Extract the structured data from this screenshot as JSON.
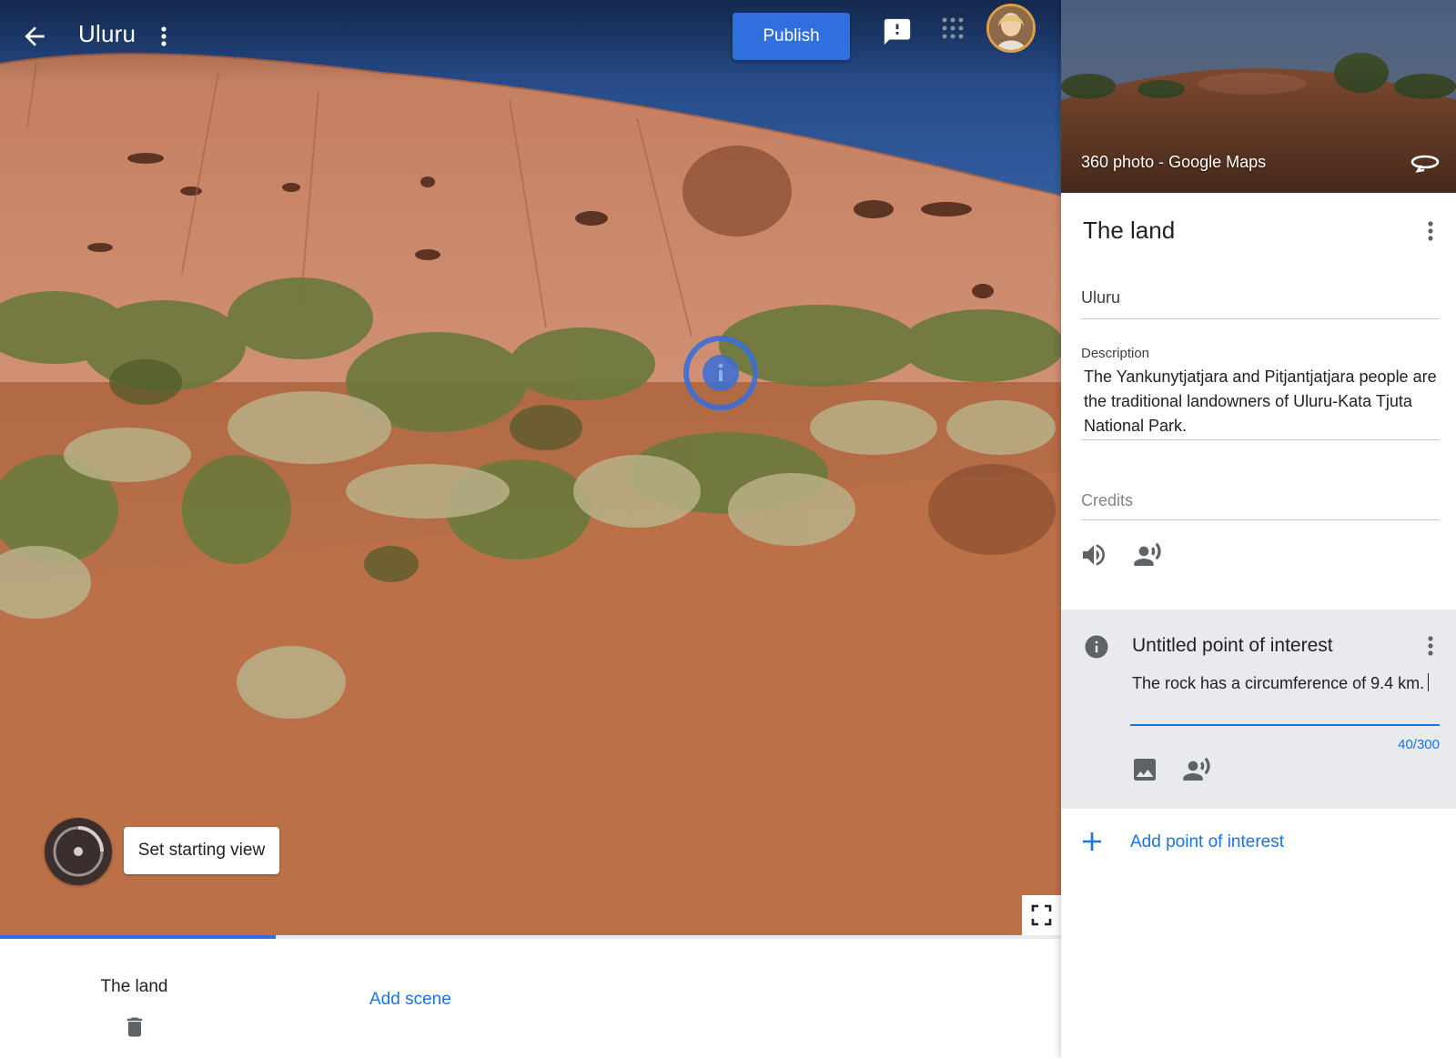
{
  "header": {
    "title": "Uluru",
    "publish_label": "Publish",
    "back_icon": "arrow-back-icon",
    "menu_icon": "more-vert-icon",
    "feedback_icon": "feedback-icon",
    "apps_icon": "apps-grid-icon"
  },
  "viewer": {
    "set_starting_view_label": "Set starting view",
    "poi_marker_icon": "info-icon",
    "fullscreen_icon": "fullscreen-icon"
  },
  "scene_strip": {
    "scenes": [
      {
        "label": "The land"
      }
    ],
    "add_scene_label": "Add scene",
    "progress_fraction": 0.26
  },
  "side_panel": {
    "preview_caption": "360 photo - Google Maps",
    "scene_title": "The land",
    "location_value": "Uluru",
    "description_label": "Description",
    "description_value": "The Yankunytjatjara and Pitjantjatjara people are the traditional landowners of Uluru-Kata Tjuta National Park.",
    "credits_placeholder": "Credits",
    "poi": {
      "title": "Untitled point of interest",
      "text": "The rock has a circumference of 9.4 km.",
      "counter": "40/300"
    },
    "add_poi_label": "Add point of interest"
  },
  "colors": {
    "accent": "#1a73e8",
    "publish": "#2f6fde",
    "sky": "#5c93e0",
    "rock": "#c98363",
    "ground": "#b8673f",
    "poi_card_bg": "#e8eaee"
  }
}
